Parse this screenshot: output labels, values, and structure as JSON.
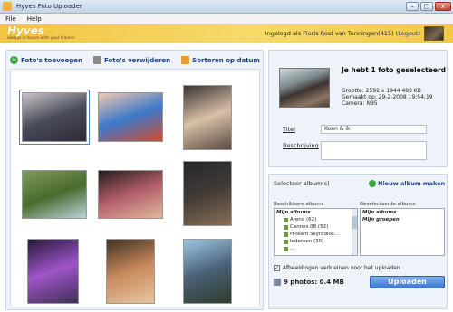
{
  "window": {
    "title": "Hyves Foto Uploader",
    "controls": [
      "–",
      "□",
      "x"
    ]
  },
  "menu": {
    "items": [
      "File",
      "Help"
    ]
  },
  "header": {
    "logo_name": "Hyves",
    "logo_tagline": "always in touch with your friends",
    "logged_in_text": "Ingelogd als Floris Rost van Tonningen(415)",
    "logout_label": "(Logout)"
  },
  "toolbar": {
    "add_label": "Foto's toevoegen",
    "remove_label": "Foto's verwijderen",
    "sort_label": "Sorteren op datum"
  },
  "photos": [
    {
      "colors": [
        "#c9c4c8",
        "#4a4c5a",
        "#2d2b33"
      ]
    },
    {
      "colors": [
        "#f2c8b0",
        "#3d79c9",
        "#d24b2f"
      ]
    },
    {
      "colors": [
        "#3a3432",
        "#d8c0a8",
        "#5b4b3f"
      ]
    },
    {
      "colors": [
        "#7e9c5c",
        "#4a6a2e",
        "#bcd2d8"
      ]
    },
    {
      "colors": [
        "#261d1b",
        "#b35f6c",
        "#e0b89a"
      ]
    },
    {
      "colors": [
        "#23262c",
        "#433c36",
        "#8a7058"
      ]
    },
    {
      "colors": [
        "#241a3a",
        "#a054c8",
        "#3d2f55"
      ]
    },
    {
      "colors": [
        "#3e3226",
        "#c98a5c",
        "#e7c6a1"
      ]
    },
    {
      "colors": [
        "#9fc7e0",
        "#4a6178",
        "#2e3c2a"
      ]
    }
  ],
  "selection": {
    "title": "Je hebt 1 foto geselecteerd",
    "size": "Grootte: 2592 x 1944 483 KB",
    "date": "Gemaakt op: 29-2-2008 19:54:19",
    "camera": "Camera: N95",
    "title_label": "Titel",
    "title_value": "Koen & ik",
    "desc_label": "Beschrijving",
    "desc_value": ""
  },
  "albums": {
    "select_label": "Selecteer album(s)",
    "new_album_label": "Nieuw album maken",
    "available_caption": "Beschikbare albums",
    "selected_caption": "Geselecteerde albums",
    "available": [
      {
        "label": "Mijn albums",
        "header": true
      },
      {
        "label": "Arend (62)",
        "header": false
      },
      {
        "label": "Cannes 08 (52)",
        "header": false
      },
      {
        "label": "H-team Skyradiox...",
        "header": false
      },
      {
        "label": "Iedereen (30)",
        "header": false
      },
      {
        "label": "...",
        "header": false
      }
    ],
    "selected": [
      {
        "label": "Mijn albums"
      },
      {
        "label": "Mijn groepen"
      }
    ],
    "resize_label": "Afbeeldingen verkleinen voor het uploaden",
    "resize_checked": true,
    "summary": "9 photos: 0.4 MB",
    "upload_label": "Uploaden"
  }
}
